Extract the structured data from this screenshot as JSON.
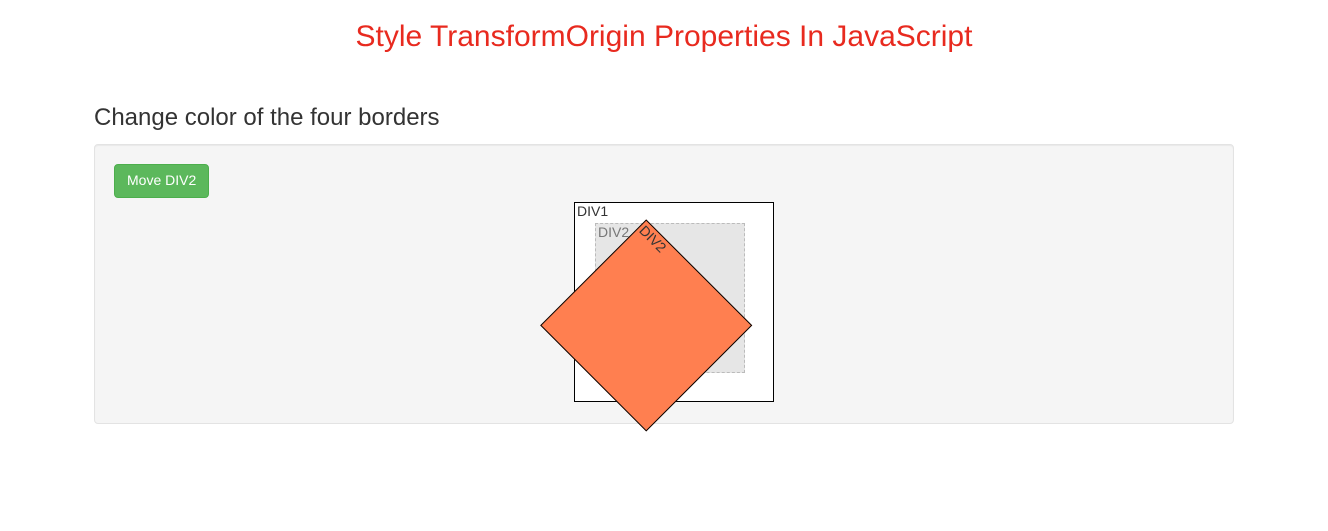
{
  "pageTitle": "Style TransformOrigin Properties In JavaScript",
  "sectionTitle": "Change color of the four borders",
  "button": {
    "label": "Move DIV2"
  },
  "demo": {
    "div1Label": "DIV1",
    "div2GhostLabel": "DIV2",
    "div2Label": "DIV2"
  }
}
